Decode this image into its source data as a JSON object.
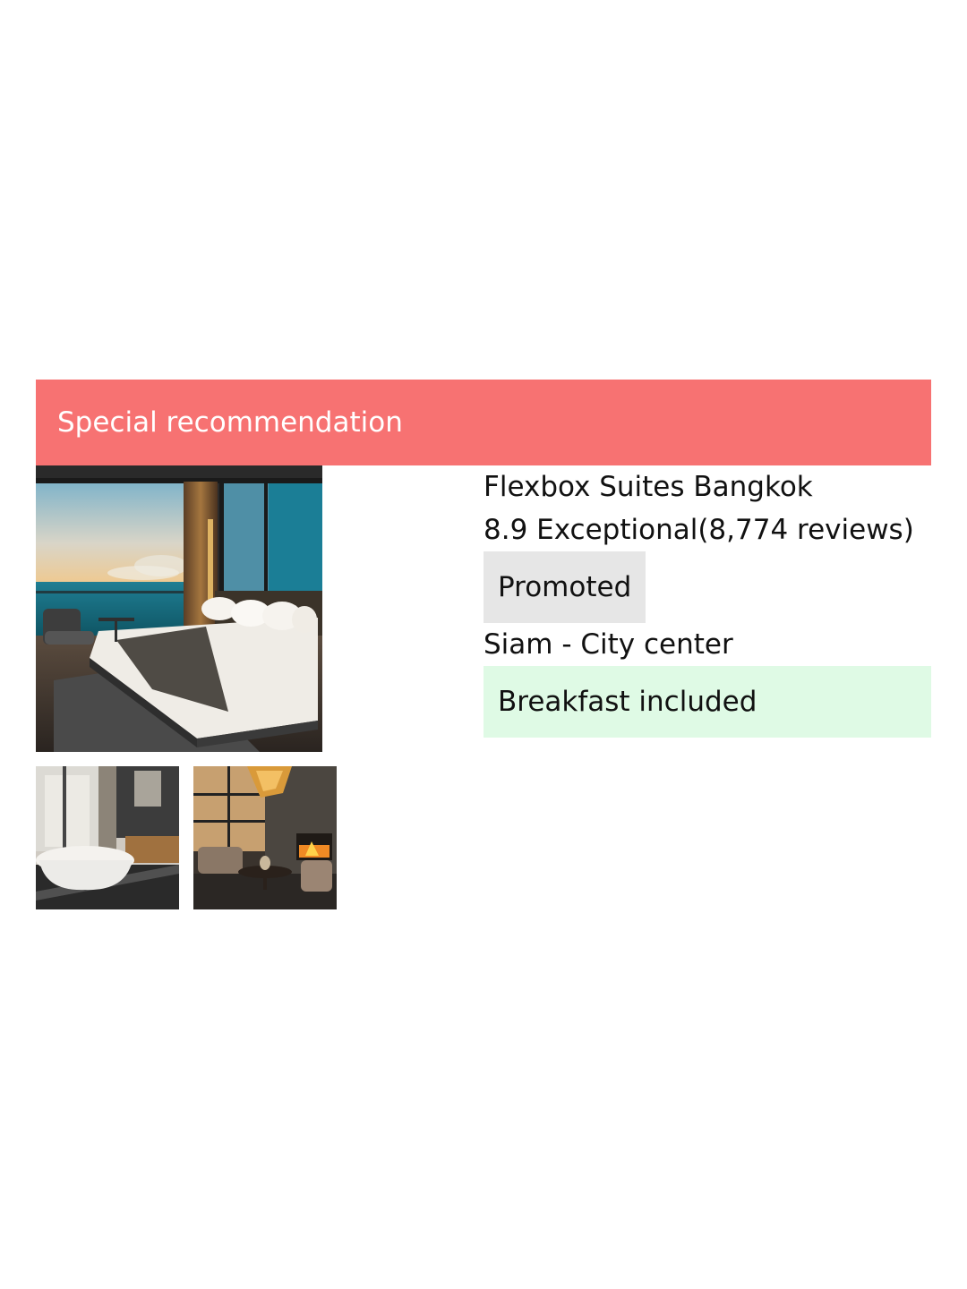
{
  "banner": {
    "label": "Special recommendation",
    "color": "#f77272"
  },
  "hotel": {
    "name": "Flexbox Suites Bangkok",
    "rating": "8.9 Exceptional(8,774 reviews)",
    "promoted_label": "Promoted",
    "location": "Siam - City center",
    "amenity": "Breakfast included"
  },
  "colors": {
    "promoted_bg": "#e6e6e6",
    "amenity_bg": "#dffae5"
  },
  "images": {
    "main": "hotel-bedroom-ocean-view",
    "thumbs": [
      "bathroom-bathtub",
      "lounge-fireplace"
    ]
  }
}
